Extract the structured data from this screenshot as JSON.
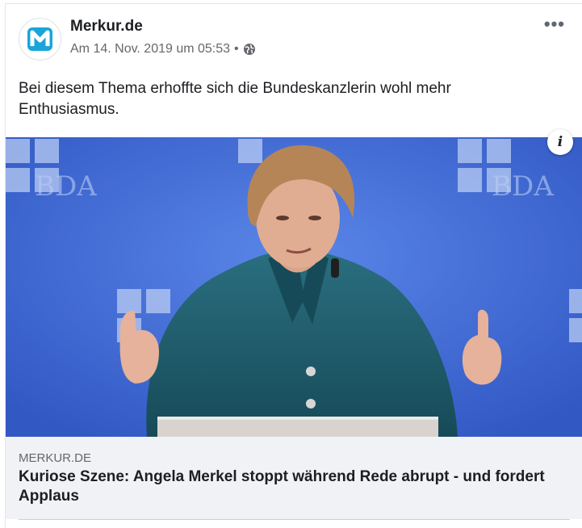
{
  "post": {
    "page_name": "Merkur.de",
    "timestamp": "Am 14. Nov. 2019 um 05:53",
    "separator": "•",
    "privacy_icon": "globe-icon",
    "more_icon": "more-options-icon",
    "more_label": "•••",
    "text": "Bei diesem Thema erhoffte sich die Bundeskanzlerin wohl mehr Enthusiasmus.",
    "avatar_logo": "M"
  },
  "image": {
    "info_label": "i",
    "background_text": "BDA"
  },
  "link_preview": {
    "domain": "MERKUR.DE",
    "headline": "Kuriose Szene: Angela Merkel stoppt während Rede abrupt - und fordert Applaus"
  },
  "colors": {
    "accent_blue": "#1aa5d9",
    "page_bg": "#ffffff",
    "preview_bg": "#f0f2f5",
    "stage_blue": "#3f6ad4",
    "jacket_teal": "#1e5a6a"
  }
}
